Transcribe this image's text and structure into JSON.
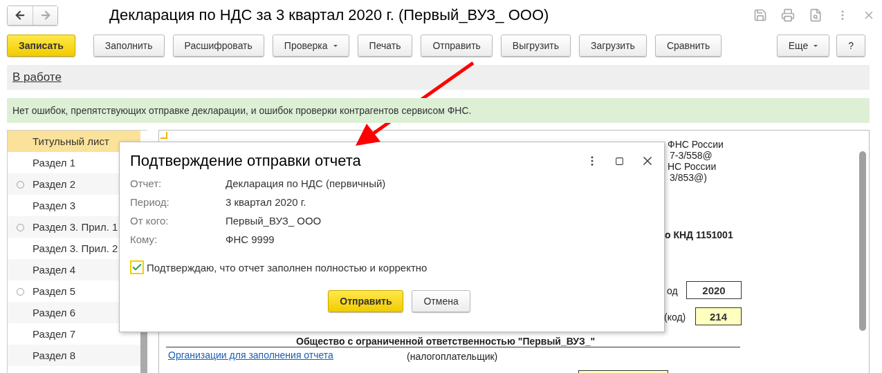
{
  "window": {
    "title": "Декларация по НДС за 3 квартал 2020 г. (Первый_ВУЗ_ ООО)"
  },
  "toolbar": [
    {
      "label": "Записать",
      "primary": true,
      "dropdown": false
    },
    {
      "label": "Заполнить",
      "primary": false,
      "dropdown": false
    },
    {
      "label": "Расшифровать",
      "primary": false,
      "dropdown": false
    },
    {
      "label": "Проверка",
      "primary": false,
      "dropdown": true
    },
    {
      "label": "Печать",
      "primary": false,
      "dropdown": false
    },
    {
      "label": "Отправить",
      "primary": false,
      "dropdown": false
    },
    {
      "label": "Выгрузить",
      "primary": false,
      "dropdown": false
    },
    {
      "label": "Загрузить",
      "primary": false,
      "dropdown": false
    },
    {
      "label": "Сравнить",
      "primary": false,
      "dropdown": false
    }
  ],
  "toolbar_right": [
    {
      "label": "Еще",
      "dropdown": true
    },
    {
      "label": "?",
      "dropdown": false
    }
  ],
  "status_link": "В работе",
  "message": "Нет ошибок, препятствующих отправке декларации, и ошибок проверки контрагентов сервисом ФНС.",
  "sections": [
    {
      "label": "Титульный лист",
      "selected": true,
      "expandable": false
    },
    {
      "label": "Раздел 1",
      "selected": false,
      "expandable": false
    },
    {
      "label": "Раздел 2",
      "selected": false,
      "expandable": true
    },
    {
      "label": "Раздел 3",
      "selected": false,
      "expandable": false
    },
    {
      "label": "Раздел 3. Прил. 1",
      "selected": false,
      "expandable": true
    },
    {
      "label": "Раздел 3. Прил. 2",
      "selected": false,
      "expandable": false
    },
    {
      "label": "Раздел 4",
      "selected": false,
      "expandable": false
    },
    {
      "label": "Раздел 5",
      "selected": false,
      "expandable": true
    },
    {
      "label": "Раздел 6",
      "selected": false,
      "expandable": false
    },
    {
      "label": "Раздел 7",
      "selected": false,
      "expandable": false
    },
    {
      "label": "Раздел 8",
      "selected": false,
      "expandable": false
    }
  ],
  "document": {
    "header_lines": [
      "ФНС России",
      "7-3/558@",
      "НС России",
      "3/853@)"
    ],
    "form_code": "о КНД 1151001",
    "year_label": "од",
    "year_value": "2020",
    "code_label": "(код)",
    "code_value": "214",
    "org_name": "Общество с ограниченной ответственностью \"Первый_ВУЗ_\"",
    "org_link": "Организации для заполнения отчета",
    "org_role": "(налогоплательщик)"
  },
  "dialog": {
    "title": "Подтверждение отправки отчета",
    "fields": [
      {
        "label": "Отчет:",
        "value": "Декларация по НДС (первичный)"
      },
      {
        "label": "Период:",
        "value": "3 квартал 2020 г."
      },
      {
        "label": "От кого:",
        "value": "Первый_ВУЗ_ ООО"
      },
      {
        "label": "Кому:",
        "value": "ФНС 9999"
      }
    ],
    "confirm": {
      "label": "Подтверждаю, что отчет заполнен полностью и корректно",
      "checked": true
    },
    "buttons": [
      {
        "label": "Отправить",
        "primary": true
      },
      {
        "label": "Отмена",
        "primary": false
      }
    ]
  }
}
